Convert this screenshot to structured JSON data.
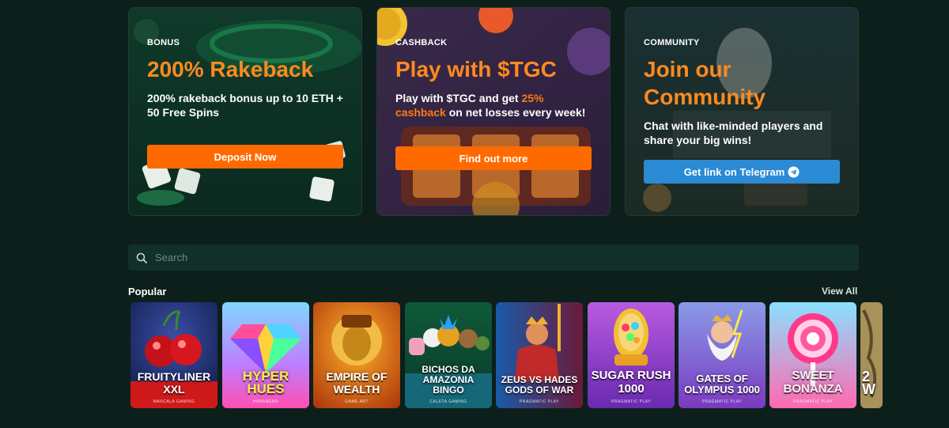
{
  "promos": [
    {
      "tag": "BONUS",
      "headline": "200% Rakeback",
      "desc": "200% rakeback bonus up to 10 ETH + 50 Free Spins",
      "cta": "Deposit Now"
    },
    {
      "tag": "CASHBACK",
      "headline": "Play with $TGC",
      "desc_pre": "Play with $TGC and get ",
      "desc_hl": "25% cashback",
      "desc_post": " on net losses every week!",
      "cta": "Find out more"
    },
    {
      "tag": "COMMUNITY",
      "headline": "Join our Community",
      "desc": "Chat with like-minded players and share your big wins!",
      "cta": "Get link on Telegram"
    }
  ],
  "search": {
    "placeholder": "Search",
    "value": ""
  },
  "popular": {
    "title": "Popular",
    "view_all": "View All",
    "games": [
      {
        "name": "Fruityliner XXL",
        "provider": "Mancala Gaming"
      },
      {
        "name": "Hyper Hues",
        "provider": "Habanero"
      },
      {
        "name": "Empire of Wealth",
        "provider": "Game Art"
      },
      {
        "name": "Bichos da Amazonia Bingo",
        "provider": "Caleta Gaming"
      },
      {
        "name": "Zeus vs Hades Gods of War",
        "provider": "Pragmatic Play"
      },
      {
        "name": "Sugar Rush 1000",
        "provider": "Pragmatic Play"
      },
      {
        "name": "Gates of Olympus 1000",
        "provider": "Pragmatic Play"
      },
      {
        "name": "Sweet Bonanza",
        "provider": "Pragmatic Play"
      },
      {
        "name": "2 W",
        "provider": ""
      }
    ]
  },
  "colors": {
    "accent": "#ff6a00",
    "headline": "#ff8a1f",
    "telegram": "#2b8ad4",
    "background": "#0c1f1b"
  },
  "icons": {
    "search": "search-icon",
    "telegram": "telegram-icon"
  }
}
